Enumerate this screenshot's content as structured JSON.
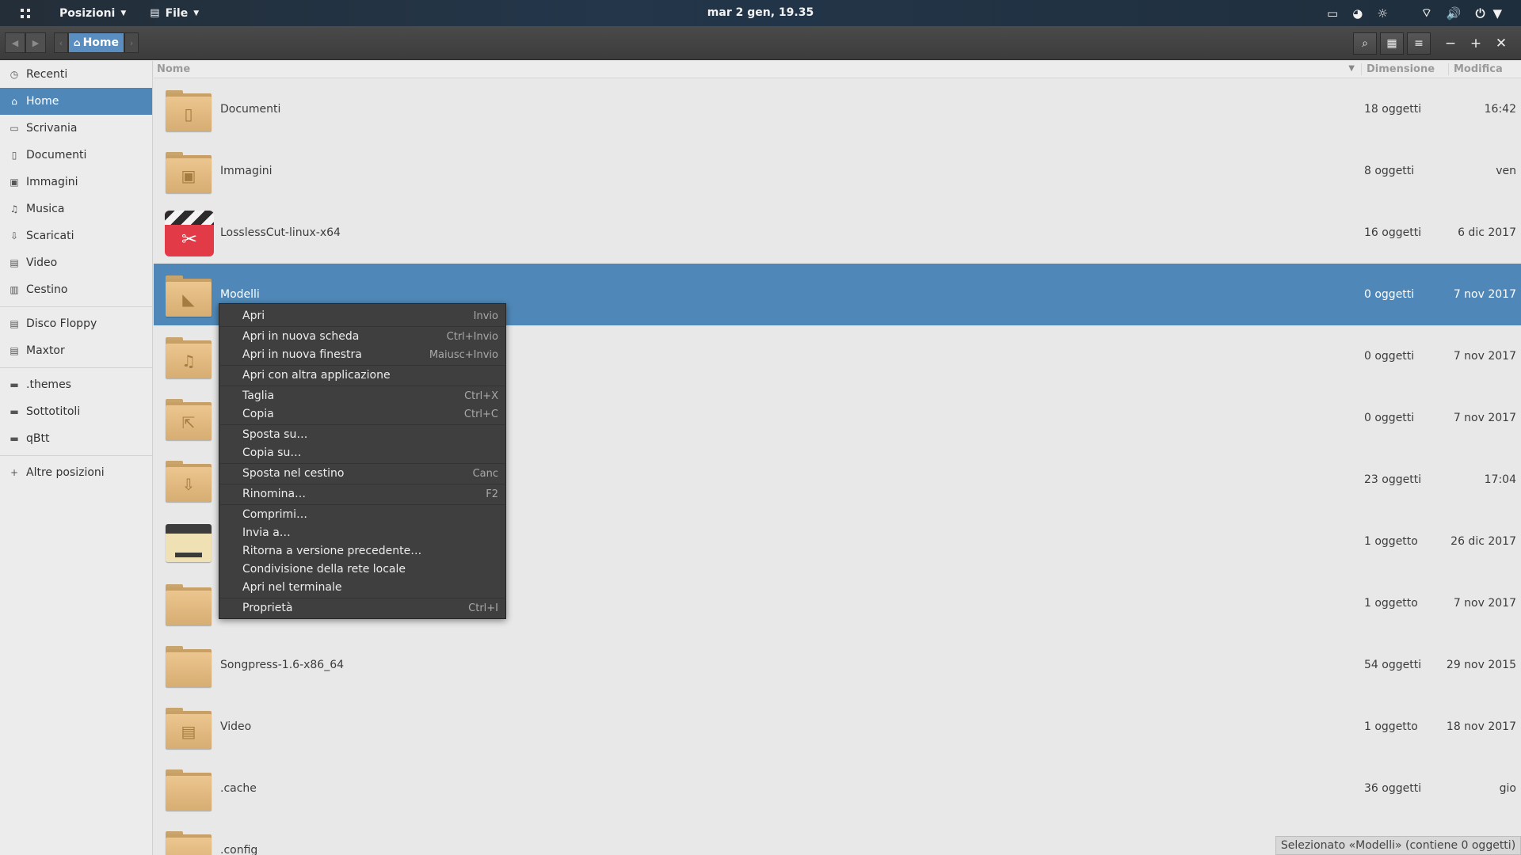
{
  "top_panel": {
    "activities_icon": "apps-grid-icon",
    "places_menu": "Posizioni",
    "app_menu": "File",
    "clock": "mar  2 gen, 19.35",
    "tray_icons": [
      "display-icon",
      "chat-icon",
      "brightness-icon",
      "wifi-icon",
      "volume-icon",
      "power-icon"
    ]
  },
  "header": {
    "location": "Home"
  },
  "sidebar": {
    "items": [
      {
        "label": "Recenti",
        "icon": "clock-icon"
      },
      {
        "label": "Home",
        "icon": "home-icon"
      },
      {
        "label": "Scrivania",
        "icon": "desktop-icon"
      },
      {
        "label": "Documenti",
        "icon": "document-icon"
      },
      {
        "label": "Immagini",
        "icon": "image-icon"
      },
      {
        "label": "Musica",
        "icon": "music-icon"
      },
      {
        "label": "Scaricati",
        "icon": "download-icon"
      },
      {
        "label": "Video",
        "icon": "video-icon"
      },
      {
        "label": "Cestino",
        "icon": "trash-icon"
      }
    ],
    "devices": [
      {
        "label": "Disco Floppy",
        "icon": "drive-icon"
      },
      {
        "label": "Maxtor",
        "icon": "drive-icon"
      }
    ],
    "bookmarks": [
      {
        "label": ".themes",
        "icon": "folder-icon"
      },
      {
        "label": "Sottotitoli",
        "icon": "folder-icon"
      },
      {
        "label": "qBtt",
        "icon": "folder-icon"
      }
    ],
    "other": {
      "label": "Altre posizioni",
      "icon": "plus-icon"
    }
  },
  "columns": {
    "name": "Nome",
    "size": "Dimensione",
    "modified": "Modifica"
  },
  "files": [
    {
      "name": "Documenti",
      "size": "18 oggetti",
      "modified": "16:42",
      "icon": "folder-documents-icon"
    },
    {
      "name": "Immagini",
      "size": "8 oggetti",
      "modified": "ven",
      "icon": "folder-pictures-icon"
    },
    {
      "name": "LosslessCut-linux-x64",
      "size": "16 oggetti",
      "modified": "6 dic 2017",
      "icon": "losslesscut-app-icon"
    },
    {
      "name": "Modelli",
      "size": "0 oggetti",
      "modified": "7 nov 2017",
      "icon": "folder-templates-icon"
    },
    {
      "name": "",
      "size": "0 oggetti",
      "modified": "7 nov 2017",
      "icon": "folder-music-icon"
    },
    {
      "name": "",
      "size": "0 oggetti",
      "modified": "7 nov 2017",
      "icon": "folder-public-icon"
    },
    {
      "name": "",
      "size": "23 oggetti",
      "modified": "17:04",
      "icon": "folder-download-icon"
    },
    {
      "name": "",
      "size": "1 oggetto",
      "modified": "26 dic 2017",
      "icon": "drive-desktop-icon"
    },
    {
      "name": "",
      "size": "1 oggetto",
      "modified": "7 nov 2017",
      "icon": "folder-icon"
    },
    {
      "name": "Songpress-1.6-x86_64",
      "size": "54 oggetti",
      "modified": "29 nov 2015",
      "icon": "folder-icon"
    },
    {
      "name": "Video",
      "size": "1 oggetto",
      "modified": "18 nov 2017",
      "icon": "folder-videos-icon"
    },
    {
      "name": ".cache",
      "size": "36 oggetti",
      "modified": "gio",
      "icon": "folder-icon"
    },
    {
      "name": ".config",
      "size": "",
      "modified": "",
      "icon": "folder-icon"
    }
  ],
  "selected_index": 3,
  "context_menu": [
    {
      "label": "Apri",
      "accel": "Invio"
    },
    {
      "label": "Apri in nuova scheda",
      "accel": "Ctrl+Invio"
    },
    {
      "label": "Apri in nuova finestra",
      "accel": "Maiusc+Invio"
    },
    {
      "label": "Apri con altra applicazione",
      "accel": ""
    },
    {
      "label": "Taglia",
      "accel": "Ctrl+X"
    },
    {
      "label": "Copia",
      "accel": "Ctrl+C"
    },
    {
      "label": "Sposta su…",
      "accel": ""
    },
    {
      "label": "Copia su…",
      "accel": ""
    },
    {
      "label": "Sposta nel cestino",
      "accel": "Canc"
    },
    {
      "label": "Rinomina…",
      "accel": "F2"
    },
    {
      "label": "Comprimi…",
      "accel": ""
    },
    {
      "label": "Invia a…",
      "accel": ""
    },
    {
      "label": "Ritorna a versione precedente…",
      "accel": ""
    },
    {
      "label": "Condivisione della rete locale",
      "accel": ""
    },
    {
      "label": "Apri nel terminale",
      "accel": ""
    },
    {
      "label": "Proprietà",
      "accel": "Ctrl+I"
    }
  ],
  "status": "Selezionato «Modelli» (contiene 0 oggetti)",
  "colors": {
    "selection": "#4f88b8",
    "folder": "#e2ba80",
    "menu_bg": "#3f3f3f",
    "panel_bg": "#23364a"
  }
}
